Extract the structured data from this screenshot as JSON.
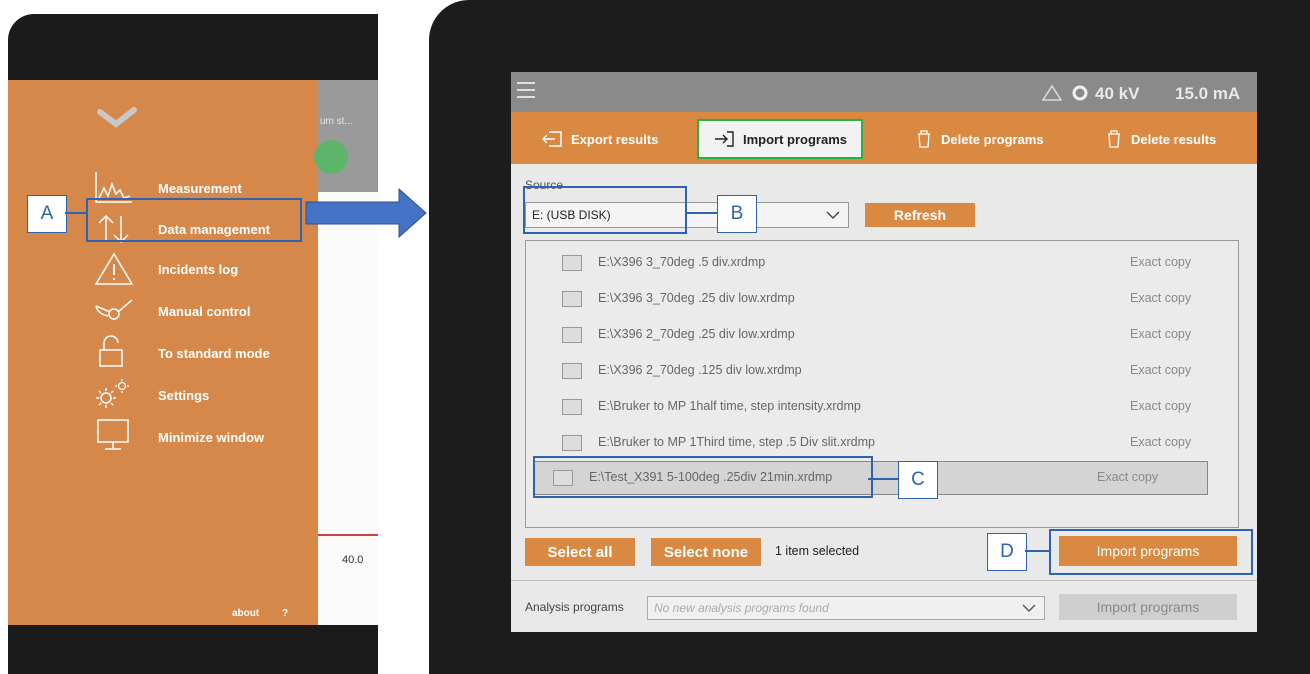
{
  "left_menu": {
    "items": [
      {
        "label": "Measurement",
        "icon": "chart-icon"
      },
      {
        "label": "Data management",
        "icon": "transfer-arrows-icon"
      },
      {
        "label": "Incidents log",
        "icon": "warning-icon"
      },
      {
        "label": "Manual control",
        "icon": "goniometer-icon"
      },
      {
        "label": "To standard mode",
        "icon": "unlock-icon"
      },
      {
        "label": "Settings",
        "icon": "gear-icon"
      },
      {
        "label": "Minimize window",
        "icon": "monitor-icon"
      }
    ],
    "footer_about": "about",
    "footer_help": "?",
    "background_fragment": "um st...",
    "background_axis_value": "40.0"
  },
  "app": {
    "status": {
      "voltage": "40 kV",
      "current": "15.0 mA"
    },
    "tabs": [
      {
        "label": "Export results",
        "active": false
      },
      {
        "label": "Import programs",
        "active": true
      },
      {
        "label": "Delete programs",
        "active": false
      },
      {
        "label": "Delete results",
        "active": false
      }
    ],
    "source_label": "Source",
    "source_value": "E: (USB DISK)",
    "refresh_label": "Refresh",
    "files": [
      {
        "name": "E:\\X396 3_70deg .5 div.xrdmp",
        "status": "Exact copy",
        "selected": false
      },
      {
        "name": "E:\\X396 3_70deg .25 div low.xrdmp",
        "status": "Exact copy",
        "selected": false
      },
      {
        "name": "E:\\X396 2_70deg .25 div low.xrdmp",
        "status": "Exact copy",
        "selected": false
      },
      {
        "name": "E:\\X396 2_70deg .125 div low.xrdmp",
        "status": "Exact copy",
        "selected": false
      },
      {
        "name": "E:\\Bruker to MP 1half time, step intensity.xrdmp",
        "status": "Exact copy",
        "selected": false
      },
      {
        "name": "E:\\Bruker to MP 1Third time, step .5 Div slit.xrdmp",
        "status": "Exact copy",
        "selected": false
      },
      {
        "name": "E:\\Test_X391 5-100deg .25div 21min.xrdmp",
        "status": "Exact copy",
        "selected": true
      }
    ],
    "select_all": "Select all",
    "select_none": "Select none",
    "selection_count": "1 item selected",
    "import_button": "Import programs",
    "analysis_label": "Analysis programs",
    "analysis_placeholder": "No new analysis programs found",
    "analysis_import_button": "Import programs"
  },
  "callouts": {
    "a": "A",
    "b": "B",
    "c": "C",
    "d": "D"
  },
  "colors": {
    "accent": "#d98942",
    "callout": "#2e63b0",
    "active_tab_border": "#28b04a"
  }
}
